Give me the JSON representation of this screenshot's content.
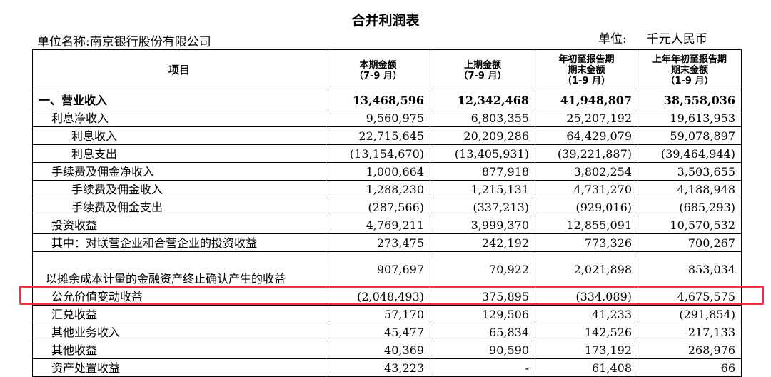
{
  "document": {
    "title": "合并利润表",
    "company_label": "单位名称:南京银行股份有限公司",
    "unit_label": "单位:",
    "unit_value": "千元人民币"
  },
  "table": {
    "headers": [
      {
        "lines": [
          "项目"
        ]
      },
      {
        "lines": [
          "本期金额",
          "（7-9 月）"
        ]
      },
      {
        "lines": [
          "上期金额",
          "（7-9 月）"
        ]
      },
      {
        "lines": [
          "年初至报告期",
          "期末金额",
          "（1-9 月）"
        ]
      },
      {
        "lines": [
          "上年年初至报告期",
          "期末金额",
          "（1-9 月）"
        ]
      }
    ],
    "rows": [
      {
        "label": "一、营业收入",
        "values": [
          "13,468,596",
          "12,342,468",
          "41,948,807",
          "38,558,036"
        ]
      },
      {
        "label": "利息净收入",
        "values": [
          "9,560,975",
          "6,803,355",
          "25,207,192",
          "19,613,953"
        ]
      },
      {
        "label": "利息收入",
        "values": [
          "22,715,645",
          "20,209,286",
          "64,429,079",
          "59,078,897"
        ]
      },
      {
        "label": "利息支出",
        "values": [
          "(13,154,670)",
          "(13,405,931)",
          "(39,221,887)",
          "(39,464,944)"
        ]
      },
      {
        "label": "手续费及佣金净收入",
        "values": [
          "1,000,664",
          "877,918",
          "3,802,254",
          "3,503,655"
        ]
      },
      {
        "label": "手续费及佣金收入",
        "values": [
          "1,288,230",
          "1,215,131",
          "4,731,270",
          "4,188,948"
        ]
      },
      {
        "label": "手续费及佣金支出",
        "values": [
          "(287,566)",
          "(337,213)",
          "(929,016)",
          "(685,293)"
        ]
      },
      {
        "label": "投资收益",
        "values": [
          "4,769,211",
          "3,999,370",
          "12,855,091",
          "10,570,532"
        ]
      },
      {
        "label": "其中：对联营企业和合营企业的投资收益",
        "values": [
          "273,475",
          "242,192",
          "773,326",
          "700,267"
        ]
      },
      {
        "label": "以摊余成本计量的金融资产终止确认产生的收益",
        "values": [
          "907,697",
          "70,922",
          "2,021,898",
          "853,034"
        ]
      },
      {
        "label": "公允价值变动收益",
        "values": [
          "(2,048,493)",
          "375,895",
          "(334,089)",
          "4,675,575"
        ]
      },
      {
        "label": "汇兑收益",
        "values": [
          "57,170",
          "129,506",
          "41,233",
          "(291,854)"
        ]
      },
      {
        "label": "其他业务收入",
        "values": [
          "45,477",
          "65,834",
          "142,526",
          "217,133"
        ]
      },
      {
        "label": "其他收益",
        "values": [
          "40,369",
          "90,590",
          "173,192",
          "268,976"
        ]
      },
      {
        "label": "资产处置收益",
        "values": [
          "43,223",
          "-",
          "61,408",
          "66"
        ]
      }
    ]
  },
  "highlight_color": "#e8333c"
}
